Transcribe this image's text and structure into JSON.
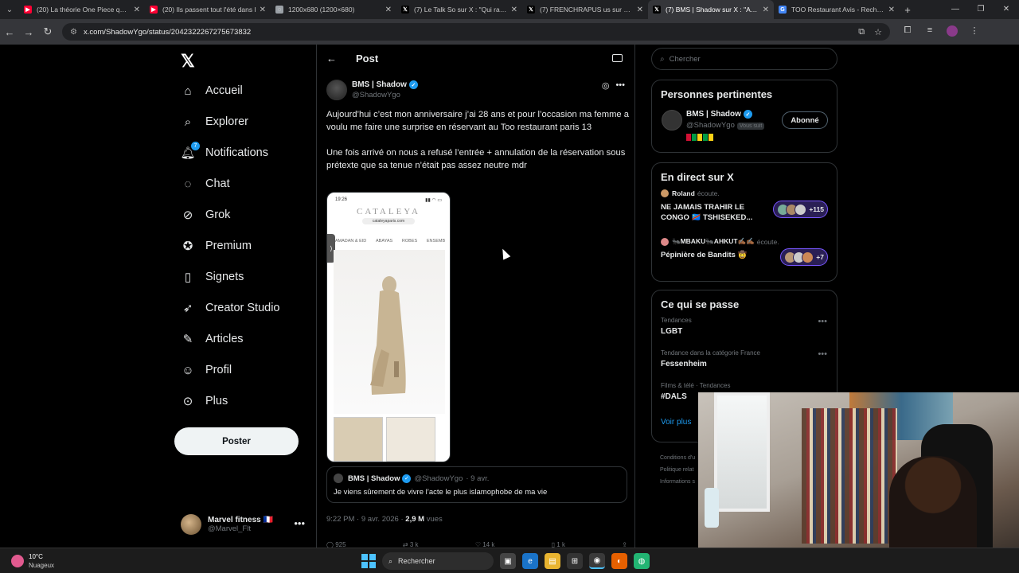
{
  "browser": {
    "tabs": [
      {
        "title": "(20) La théorie One Piece qui e",
        "icon": "youtube-icon",
        "color": "#ff0033"
      },
      {
        "title": "(20) Ils passent tout l'été dans l",
        "icon": "youtube-icon",
        "color": "#ff0033"
      },
      {
        "title": "1200x680 (1200×680)",
        "icon": "globe-icon",
        "color": "#9aa0a6"
      },
      {
        "title": "(7) Le Talk So sur X : \"Qui rap le",
        "icon": "x-icon",
        "color": "#ffffff"
      },
      {
        "title": "(7) FRENCHRAPUS us sur X : \"",
        "icon": "x-icon",
        "color": "#ffffff"
      },
      {
        "title": "(7) BMS | Shadow sur X : \"Aujou",
        "icon": "x-icon",
        "color": "#ffffff",
        "active": true
      },
      {
        "title": "TOO Restaurant Avis - Recherch",
        "icon": "google-icon",
        "color": "#4285f4"
      }
    ],
    "url": "x.com/ShadowYgo/status/2042322267275673832"
  },
  "nav": {
    "items": [
      {
        "label": "Accueil",
        "icon": "home-icon"
      },
      {
        "label": "Explorer",
        "icon": "search-icon"
      },
      {
        "label": "Notifications",
        "icon": "bell-icon",
        "badge": "7"
      },
      {
        "label": "Chat",
        "icon": "chat-icon"
      },
      {
        "label": "Grok",
        "icon": "grok-icon"
      },
      {
        "label": "Premium",
        "icon": "premium-icon"
      },
      {
        "label": "Signets",
        "icon": "bookmark-icon"
      },
      {
        "label": "Creator Studio",
        "icon": "rocket-icon"
      },
      {
        "label": "Articles",
        "icon": "article-icon"
      },
      {
        "label": "Profil",
        "icon": "person-icon"
      },
      {
        "label": "Plus",
        "icon": "more-circle-icon"
      }
    ],
    "post_button": "Poster",
    "account": {
      "name": "Marvel fitness 🇫🇷",
      "handle": "@Marvel_Flt"
    }
  },
  "post": {
    "header_title": "Post",
    "author_name": "BMS | Shadow",
    "author_handle": "@ShadowYgo",
    "text_p1": "Aujourd’hui c’est mon anniversaire j’ai 28 ans et pour l’occasion ma femme a voulu me faire une surprise en réservant au Too restaurant paris 13",
    "text_p2": "Une fois arrivé on nous a refusé l’entrée + annulation de la réservation sous prétexte que sa tenue n’était pas assez neutre mdr",
    "media": {
      "time": "19:26",
      "brand": "CATALEYA",
      "url": "cataleyaparis.com",
      "menu": [
        "RAMADAN & EID",
        "ABAYAS",
        "ROBES",
        "ENSEMB"
      ]
    },
    "quote": {
      "name": "BMS | Shadow",
      "handle": "@ShadowYgo",
      "date": "· 9 avr.",
      "text": "Je viens sûrement de vivre l’acte le plus islamophobe de ma vie"
    },
    "timestamp": "9:22 PM · 9 avr. 2026 ·",
    "views": "2,9 M",
    "views_label": "vues",
    "actions": [
      "925",
      "3 k",
      "14 k",
      "1 k"
    ]
  },
  "sidebar": {
    "search_placeholder": "Chercher",
    "relevant_title": "Personnes pertinentes",
    "relevant": {
      "name": "BMS | Shadow",
      "handle": "@ShadowYgo",
      "follows_you": "Vous suit",
      "follow_label": "Abonné"
    },
    "live_title": "En direct sur X",
    "live": [
      {
        "who": "Roland",
        "status": "écoute.",
        "title": "NE JAMAIS TRAHIR LE CONGO 🇨🇩 TSHISEKED...",
        "count": "+115"
      },
      {
        "who": "🐜MBAKU🐜AHKUT✍🏾✍🏾",
        "status": "écoute.",
        "title": "Pépinière de Bandits 🤠",
        "count": "+7"
      }
    ],
    "happening_title": "Ce qui se passe",
    "trends": [
      {
        "category": "Tendances",
        "name": "LGBT"
      },
      {
        "category": "Tendance dans la catégorie France",
        "name": "Fessenheim"
      },
      {
        "category": "Films & télé · Tendances",
        "name": "#DALS"
      }
    ],
    "see_more": "Voir plus",
    "footer": [
      "Conditions d'u",
      "Politique relat",
      "Informations s"
    ]
  },
  "taskbar": {
    "temp": "10°C",
    "weather": "Nuageux",
    "search": "Rechercher"
  }
}
